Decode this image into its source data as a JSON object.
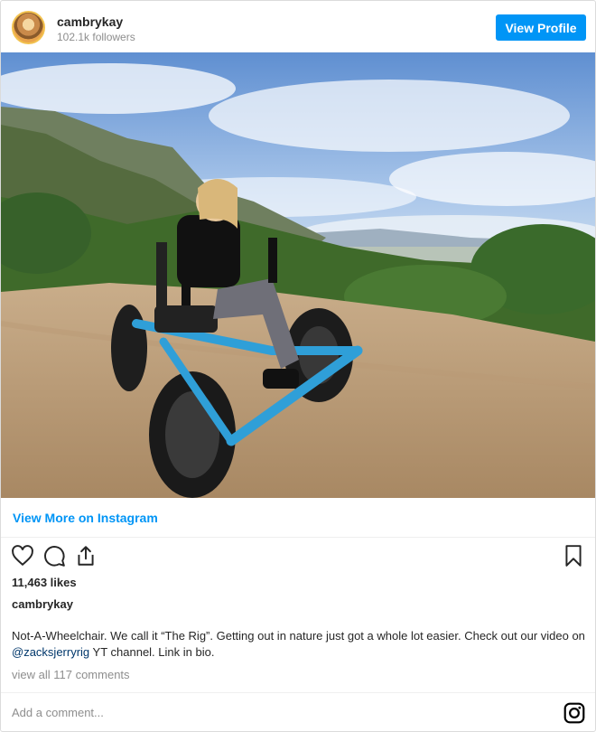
{
  "header": {
    "username": "cambrykay",
    "followers": "102.1k followers",
    "view_profile_label": "View Profile"
  },
  "photo": {
    "description_icon": "photo-rig-offroad"
  },
  "links": {
    "view_more": "View More on Instagram"
  },
  "post": {
    "likes": "11,463 likes",
    "caption_user": "cambrykay",
    "caption_text_before": "Not-A-Wheelchair. We call it “The Rig”. Getting out in nature just got a whole lot easier. Check out our video on ",
    "caption_mention": "@zacksjerryrig",
    "caption_text_after": " YT channel. Link in bio.",
    "comments_link": "view all 117 comments"
  },
  "footer": {
    "add_comment_placeholder": "Add a comment..."
  },
  "colors": {
    "accent": "#0095f6",
    "mention": "#00376b",
    "muted": "#8e8e8e",
    "rig_blue": "#2f9fd8"
  }
}
